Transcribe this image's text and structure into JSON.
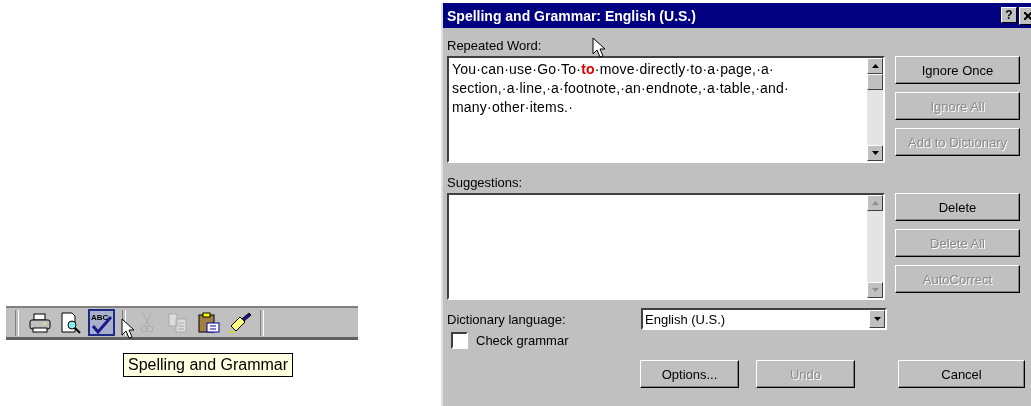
{
  "toolbar": {
    "buttons": [
      {
        "kind": "print",
        "selected": false,
        "disabled": false
      },
      {
        "kind": "preview",
        "selected": false,
        "disabled": false
      },
      {
        "kind": "spelling",
        "selected": true,
        "disabled": false,
        "icon_text": "ABC"
      },
      {
        "kind": "cut",
        "selected": false,
        "disabled": true
      },
      {
        "kind": "copy",
        "selected": false,
        "disabled": true
      },
      {
        "kind": "paste",
        "selected": false,
        "disabled": false
      },
      {
        "kind": "painter",
        "selected": false,
        "disabled": false
      }
    ],
    "tooltip": "Spelling and Grammar"
  },
  "dialog": {
    "title": "Spelling and Grammar: English (U.S.)",
    "help_button": "?",
    "problem_label": "Repeated Word:",
    "problem_text": "You·can·use·Go·To·**to**·move·directly·to·a·page,·a· section,·a·line,·a·footnote,·an·endnote,·a·table,·and· many·other·items.·",
    "suggestions_label": "Suggestions:",
    "upper_buttons": [
      {
        "label": "Ignore Once",
        "disabled": false
      },
      {
        "label": "Ignore All",
        "disabled": true
      },
      {
        "label": "Add to Dictionary",
        "disabled": true
      }
    ],
    "lower_buttons": [
      {
        "label": "Delete",
        "disabled": false
      },
      {
        "label": "Delete All",
        "disabled": true
      },
      {
        "label": "AutoCorrect",
        "disabled": true
      }
    ],
    "dictionary_label": "Dictionary language:",
    "dictionary_value": "English (U.S.)",
    "check_grammar": {
      "label": "Check grammar",
      "checked": false
    },
    "bottom_buttons": [
      {
        "label": "Options...",
        "disabled": false
      },
      {
        "label": "Undo",
        "disabled": true
      },
      {
        "label": "Cancel",
        "disabled": false
      }
    ]
  }
}
